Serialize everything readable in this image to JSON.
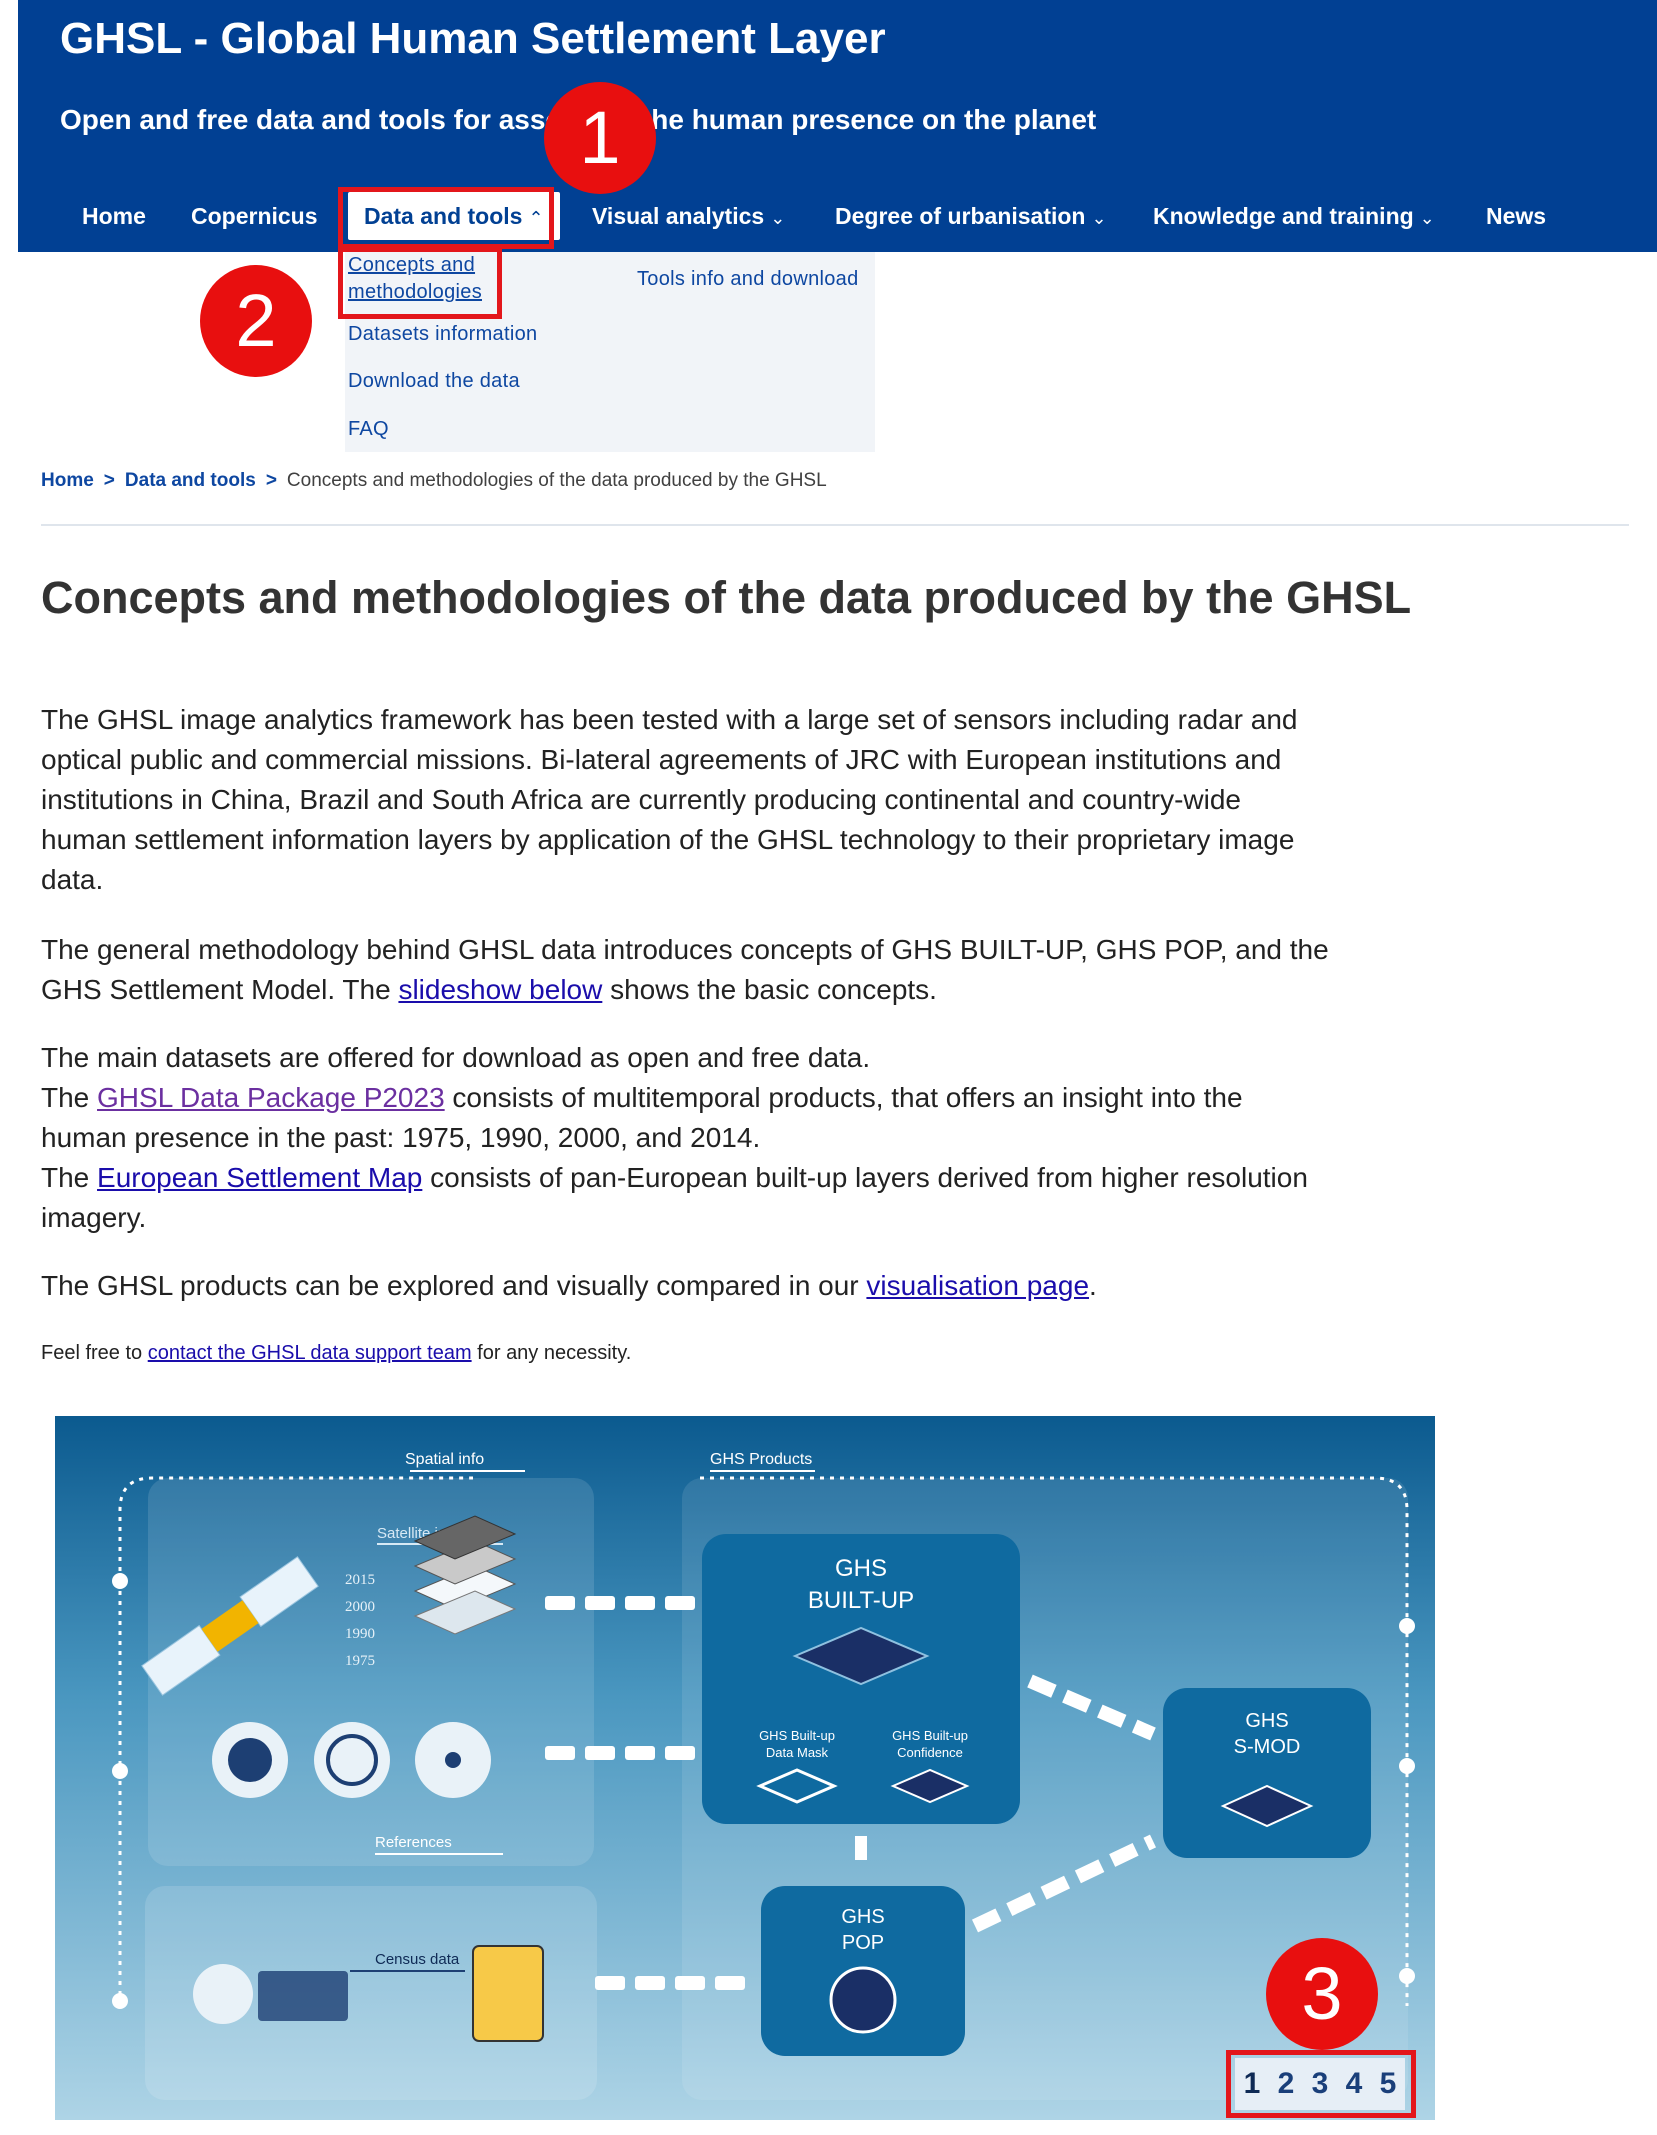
{
  "header": {
    "title": "GHSL - Global Human Settlement Layer",
    "subtitle": "Open and free data and tools for assessing the human presence on the planet",
    "background": "#014093"
  },
  "nav": {
    "items": [
      {
        "label": "Home",
        "chevron": ""
      },
      {
        "label": "Copernicus",
        "chevron": ""
      },
      {
        "label": "Data and tools",
        "chevron": "⌃"
      },
      {
        "label": "Visual analytics",
        "chevron": "⌄"
      },
      {
        "label": "Degree of urbanisation",
        "chevron": "⌄"
      },
      {
        "label": "Knowledge and training",
        "chevron": "⌄"
      },
      {
        "label": "News",
        "chevron": ""
      }
    ]
  },
  "dropdown": {
    "col1": [
      "Concepts and",
      "methodologies",
      "Datasets information",
      "Download the data",
      "FAQ"
    ],
    "col2": [
      "Tools info and download"
    ]
  },
  "breadcrumb": {
    "items": [
      "Home",
      "Data and tools"
    ],
    "current": "Concepts and methodologies of the data produced by the GHSL",
    "separator": ">"
  },
  "page_title": "Concepts and methodologies of the data produced by the GHSL",
  "content": {
    "p1": "The GHSL image analytics framework has been tested with a large set of sensors including radar and optical public and commercial missions. Bi-lateral agreements of JRC with European institutions and institutions in China, Brazil and South Africa are currently producing continental and country-wide human settlement information layers by application of the GHSL technology to their proprietary image data.",
    "p2_pre": "The general methodology behind GHSL data introduces concepts of GHS BUILT-UP, GHS POP, and the GHS Settlement Model. The ",
    "p2_link": "slideshow below",
    "p2_post": " shows the basic concepts.",
    "p3_line1": "The main datasets are offered for download as open and free data.",
    "p3_pre2": "The ",
    "p3_link2": "GHSL Data Package P2023",
    "p3_post2": " consists of multitemporal products, that offers an insight into the human presence in the past: 1975, 1990, 2000, and 2014.",
    "p3_pre3": "The ",
    "p3_link3": "European Settlement Map",
    "p3_post3": " consists of pan-European built-up layers derived from higher resolution imagery.",
    "p4_pre": "The GHSL products can be explored and visually compared in our ",
    "p4_link": "visualisation page",
    "p4_post": ".",
    "small_pre": "Feel free to ",
    "small_link": "contact the GHSL data support team",
    "small_post": " for any necessity."
  },
  "slide": {
    "spatial_info": "Spatial info",
    "ghs_products": "GHS Products",
    "satellite_imagery": "Satellite imagery",
    "years": [
      "2015",
      "2000",
      "1990",
      "1975"
    ],
    "references": "References",
    "census_data": "Census data",
    "built_up": [
      "GHS",
      "BUILT-UP"
    ],
    "data_mask": [
      "GHS Built-up",
      "Data Mask"
    ],
    "confidence": [
      "GHS Built-up",
      "Confidence"
    ],
    "smod": [
      "GHS",
      "S-MOD"
    ],
    "pop": [
      "GHS",
      "POP"
    ]
  },
  "pager": {
    "pages": [
      "1",
      "2",
      "3",
      "4",
      "5"
    ],
    "current": "1"
  },
  "markers": [
    "1",
    "2",
    "3"
  ],
  "colors": {
    "accent_red": "#e3161b",
    "link": "#0e47a1",
    "visited_link": "#6b2fa0"
  }
}
